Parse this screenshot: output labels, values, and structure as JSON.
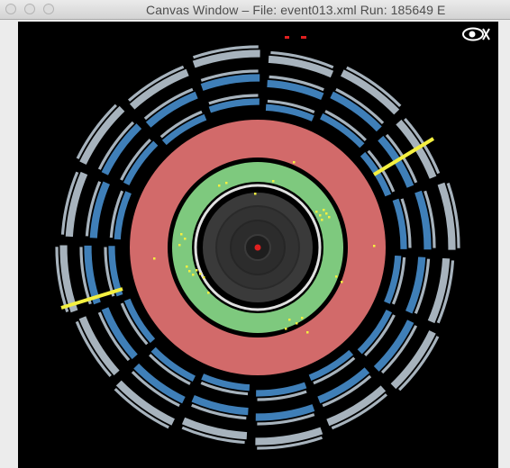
{
  "window": {
    "title": "Canvas Window –  File: event013.xml  Run: 185649  E"
  },
  "toolbar": {
    "view_icon": "eye-icon"
  },
  "colors": {
    "canvas_bg": "#000000",
    "muon_chamber_blue": "#3f7fb8",
    "muon_chamber_grey": "#a7b3bd",
    "calorimeter_hadronic": "#d26a6a",
    "calorimeter_em": "#7ec97e",
    "inner_tracker": "#3a3a3a",
    "track_yellow": "#f4f040",
    "vertex_red": "#e02020"
  }
}
